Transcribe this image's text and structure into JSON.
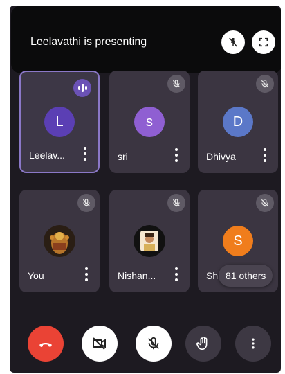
{
  "banner": {
    "text": "Leelavathi is presenting"
  },
  "tiles": [
    {
      "name": "Leelav...",
      "initial": "L",
      "avatar_color": "#5b3fb4"
    },
    {
      "name": "sri",
      "initial": "s",
      "avatar_color": "#8f5fd2"
    },
    {
      "name": "Dhivya",
      "initial": "D",
      "avatar_color": "#5b78c8"
    },
    {
      "name": "You"
    },
    {
      "name": "Nishan..."
    },
    {
      "name": "Sh",
      "initial": "S",
      "avatar_color": "#f07d1c"
    }
  ],
  "others": {
    "label": "81 others"
  },
  "colors": {
    "end_call": "#ea4335",
    "background": "#1d1a21",
    "tile": "#3b3541",
    "speaking": "#6b52b6"
  },
  "icons": {
    "banner_pin": "pin-off-icon",
    "banner_fullscreen": "fullscreen-icon",
    "end_call": "phone-hangup-icon",
    "camera": "camera-off-icon",
    "mic": "mic-off-icon",
    "raise_hand": "hand-icon",
    "more": "more-vert-icon"
  }
}
